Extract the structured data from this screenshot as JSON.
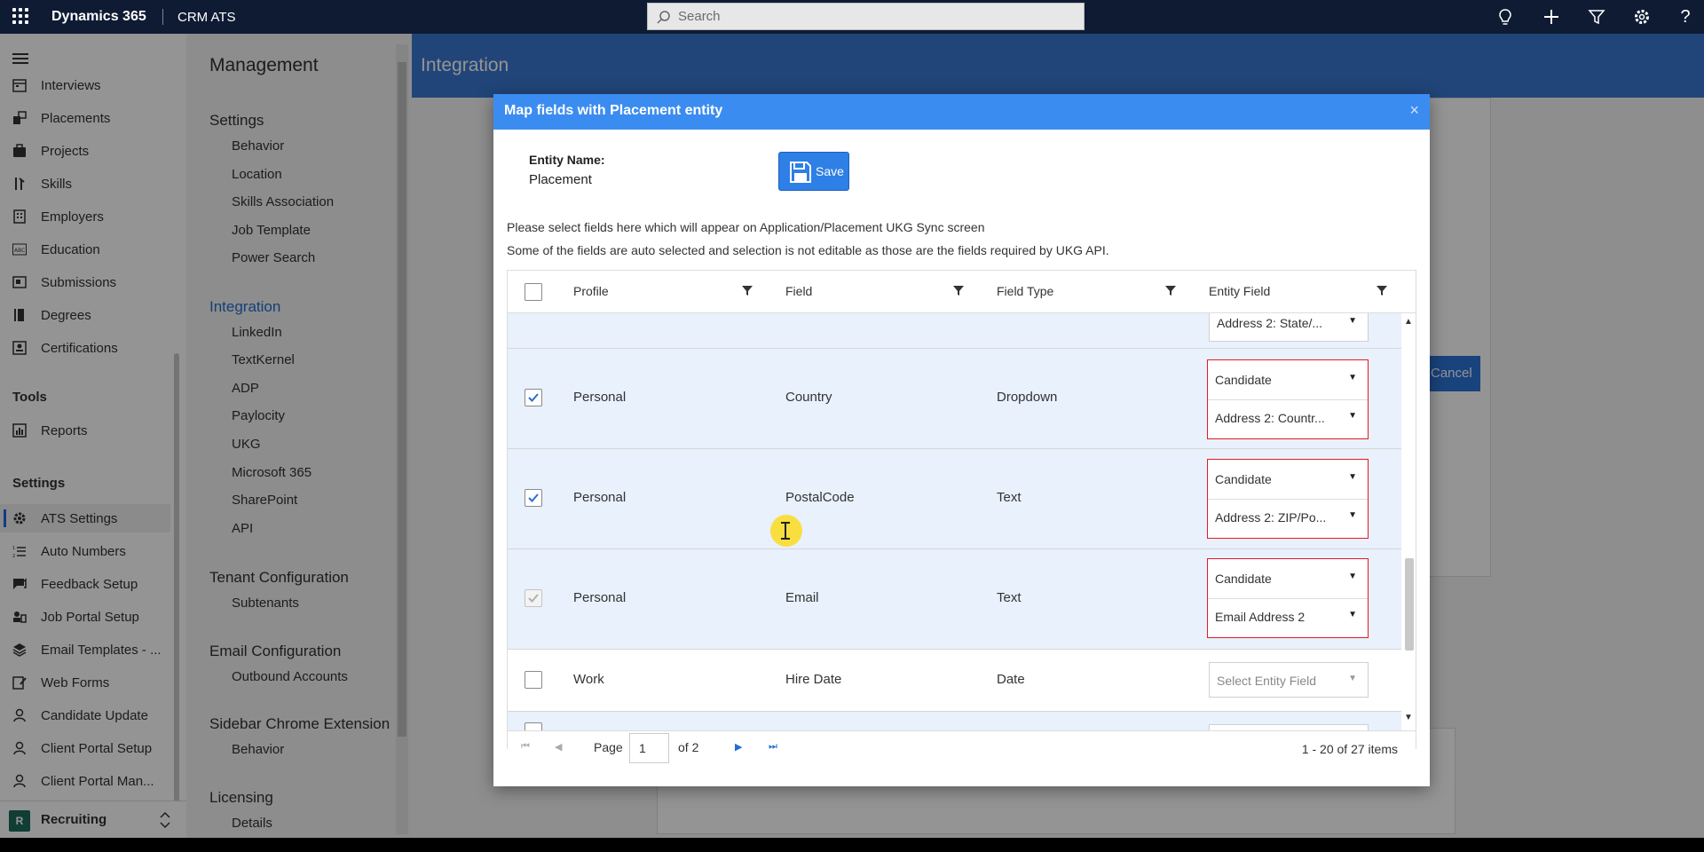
{
  "topbar": {
    "brand": "Dynamics 365",
    "app_name": "CRM ATS",
    "search_placeholder": "Search"
  },
  "leftnav": {
    "items": [
      {
        "label": "Interviews",
        "icon": "calendar-icon"
      },
      {
        "label": "Placements",
        "icon": "placement-icon"
      },
      {
        "label": "Projects",
        "icon": "briefcase-icon"
      },
      {
        "label": "Skills",
        "icon": "skills-icon"
      },
      {
        "label": "Employers",
        "icon": "building-icon"
      },
      {
        "label": "Education",
        "icon": "abc-icon"
      },
      {
        "label": "Submissions",
        "icon": "submission-icon"
      },
      {
        "label": "Degrees",
        "icon": "book-icon"
      },
      {
        "label": "Certifications",
        "icon": "certificate-icon"
      }
    ],
    "tools_section": "Tools",
    "tools_items": [
      {
        "label": "Reports",
        "icon": "report-icon"
      }
    ],
    "settings_section": "Settings",
    "settings_items": [
      {
        "label": "ATS Settings",
        "icon": "gear-icon",
        "active": true
      },
      {
        "label": "Auto Numbers",
        "icon": "list-number-icon"
      },
      {
        "label": "Feedback Setup",
        "icon": "feedback-icon"
      },
      {
        "label": "Job Portal Setup",
        "icon": "portal-icon"
      },
      {
        "label": "Email Templates - ...",
        "icon": "layers-icon"
      },
      {
        "label": "Web Forms",
        "icon": "form-icon"
      },
      {
        "label": "Candidate Update",
        "icon": "person-icon"
      },
      {
        "label": "Client Portal Setup",
        "icon": "person-icon"
      },
      {
        "label": "Client Portal Man...",
        "icon": "person-icon"
      }
    ],
    "area": {
      "initial": "R",
      "label": "Recruiting"
    }
  },
  "management": {
    "title": "Management",
    "groups": [
      {
        "label": "Settings",
        "items": [
          "Behavior",
          "Location",
          "Skills Association",
          "Job Template",
          "Power Search"
        ]
      },
      {
        "label": "Integration",
        "items": [
          "LinkedIn",
          "TextKernel",
          "ADP",
          "Paylocity",
          "UKG",
          "Microsoft 365",
          "SharePoint",
          "API"
        ]
      },
      {
        "label": "Tenant Configuration",
        "items": [
          "Subtenants"
        ]
      },
      {
        "label": "Email Configuration",
        "items": [
          "Outbound Accounts"
        ]
      },
      {
        "label": "Sidebar Chrome Extension",
        "items": [
          "Behavior"
        ]
      },
      {
        "label": "Licensing",
        "items": [
          "Details"
        ]
      }
    ]
  },
  "content": {
    "header_title": "Integration",
    "cancel_label": "Cancel"
  },
  "modal": {
    "title": "Map fields with Placement entity",
    "entity_name_label": "Entity Name:",
    "entity_name_value": "Placement",
    "save_label": "Save",
    "info_line1": "Please select fields here which will appear on Application/Placement UKG Sync screen",
    "info_line2": "Some of the fields are auto selected and selection is not editable as those are the fields required by UKG API.",
    "columns": [
      "Profile",
      "Field",
      "Field Type",
      "Entity Field"
    ],
    "partial_top_field": "Address 2: State/...",
    "rows": [
      {
        "checked": true,
        "disabled": false,
        "profile": "Personal",
        "field": "Country",
        "type": "Dropdown",
        "entity": "Candidate",
        "entity_field": "Address 2: Countr..."
      },
      {
        "checked": true,
        "disabled": false,
        "profile": "Personal",
        "field": "PostalCode",
        "type": "Text",
        "entity": "Candidate",
        "entity_field": "Address 2: ZIP/Po..."
      },
      {
        "checked": true,
        "disabled": true,
        "profile": "Personal",
        "field": "Email",
        "type": "Text",
        "entity": "Candidate",
        "entity_field": "Email Address 2"
      },
      {
        "checked": false,
        "disabled": false,
        "profile": "Work",
        "field": "Hire Date",
        "type": "Date",
        "entity_placeholder": "Select Entity Field"
      }
    ],
    "pager": {
      "page_label": "Page",
      "page_value": "1",
      "of_label": "of 2",
      "count": "1 - 20 of 27 items"
    }
  }
}
